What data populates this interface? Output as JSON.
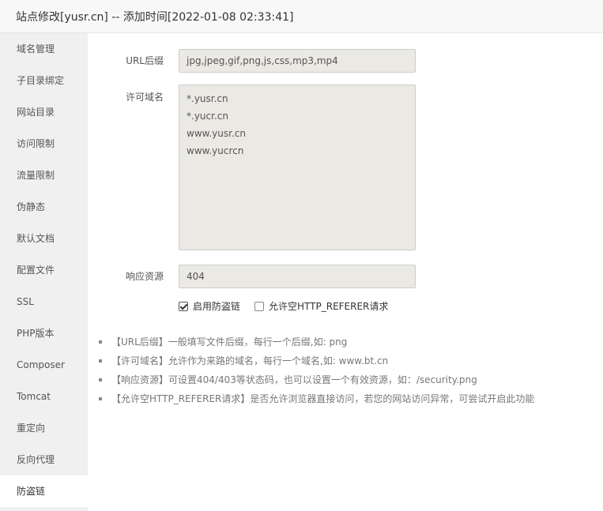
{
  "window": {
    "title": "站点修改[yusr.cn] -- 添加时间[2022-01-08 02:33:41]"
  },
  "sidebar": {
    "items": [
      {
        "label": "域名管理"
      },
      {
        "label": "子目录绑定"
      },
      {
        "label": "网站目录"
      },
      {
        "label": "访问限制"
      },
      {
        "label": "流量限制"
      },
      {
        "label": "伪静态"
      },
      {
        "label": "默认文档"
      },
      {
        "label": "配置文件"
      },
      {
        "label": "SSL"
      },
      {
        "label": "PHP版本"
      },
      {
        "label": "Composer"
      },
      {
        "label": "Tomcat"
      },
      {
        "label": "重定向"
      },
      {
        "label": "反向代理"
      },
      {
        "label": "防盗链"
      }
    ],
    "active_index": 14
  },
  "form": {
    "url_suffix_label": "URL后缀",
    "url_suffix_value": "jpg,jpeg,gif,png,js,css,mp3,mp4",
    "allowed_domains_label": "许可域名",
    "allowed_domains": [
      "*.yusr.cn",
      "*.yucr.cn",
      "www.yusr.cn",
      "www.yucrcn"
    ],
    "response_label": "响应资源",
    "response_value": "404",
    "enable_hotlink_label": "启用防盗链",
    "enable_hotlink_checked": true,
    "allow_empty_referer_label": "允许空HTTP_REFERER请求",
    "allow_empty_referer_checked": false
  },
  "help": [
    "【URL后缀】一般填写文件后缀，每行一个后缀,如: png",
    "【许可域名】允许作为来路的域名，每行一个域名,如: www.bt.cn",
    "【响应资源】可设置404/403等状态码，也可以设置一个有效资源，如：/security.png",
    "【允许空HTTP_REFERER请求】是否允许浏览器直接访问，若您的网站访问异常，可尝试开启此功能"
  ]
}
